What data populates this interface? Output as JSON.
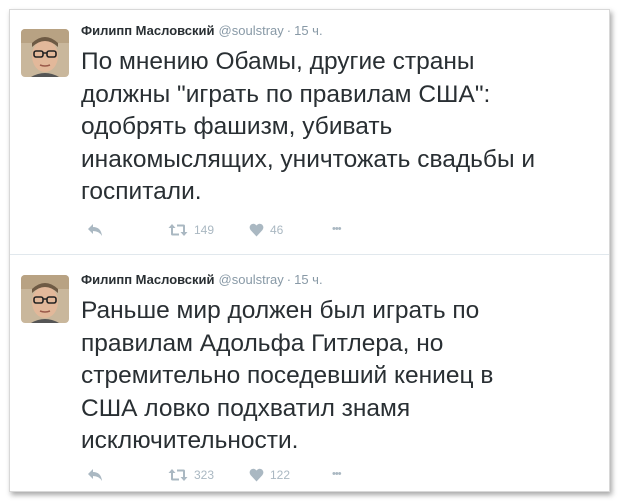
{
  "tweets": [
    {
      "author_name": "Филипп Масловский",
      "handle": "@soulstray",
      "separator": "·",
      "time": "15 ч.",
      "text": "По мнению Обамы, другие страны\nдолжны \"играть по правилам США\":\nодобрять фашизм, убивать\nинакомыслящих, уничтожать свадьбы и\nгоспитали.",
      "retweets": "149",
      "likes": "46",
      "more": "•••"
    },
    {
      "author_name": "Филипп Масловский",
      "handle": "@soulstray",
      "separator": "·",
      "time": "15 ч.",
      "text": "Раньше мир должен был играть по\nправилам Адольфа Гитлера, но\nстремительно поседевший кениец в\nСША ловко подхватил знамя\nисключительности.",
      "retweets": "323",
      "likes": "122",
      "more": "•••"
    }
  ],
  "icons": {
    "reply": "reply-icon",
    "retweet": "retweet-icon",
    "like": "heart-icon",
    "more": "more-icon",
    "avatar": "avatar"
  },
  "colors": {
    "text": "#292f33",
    "muted": "#8899a6",
    "action": "#aab8c2",
    "divider": "#e1e8ed"
  }
}
